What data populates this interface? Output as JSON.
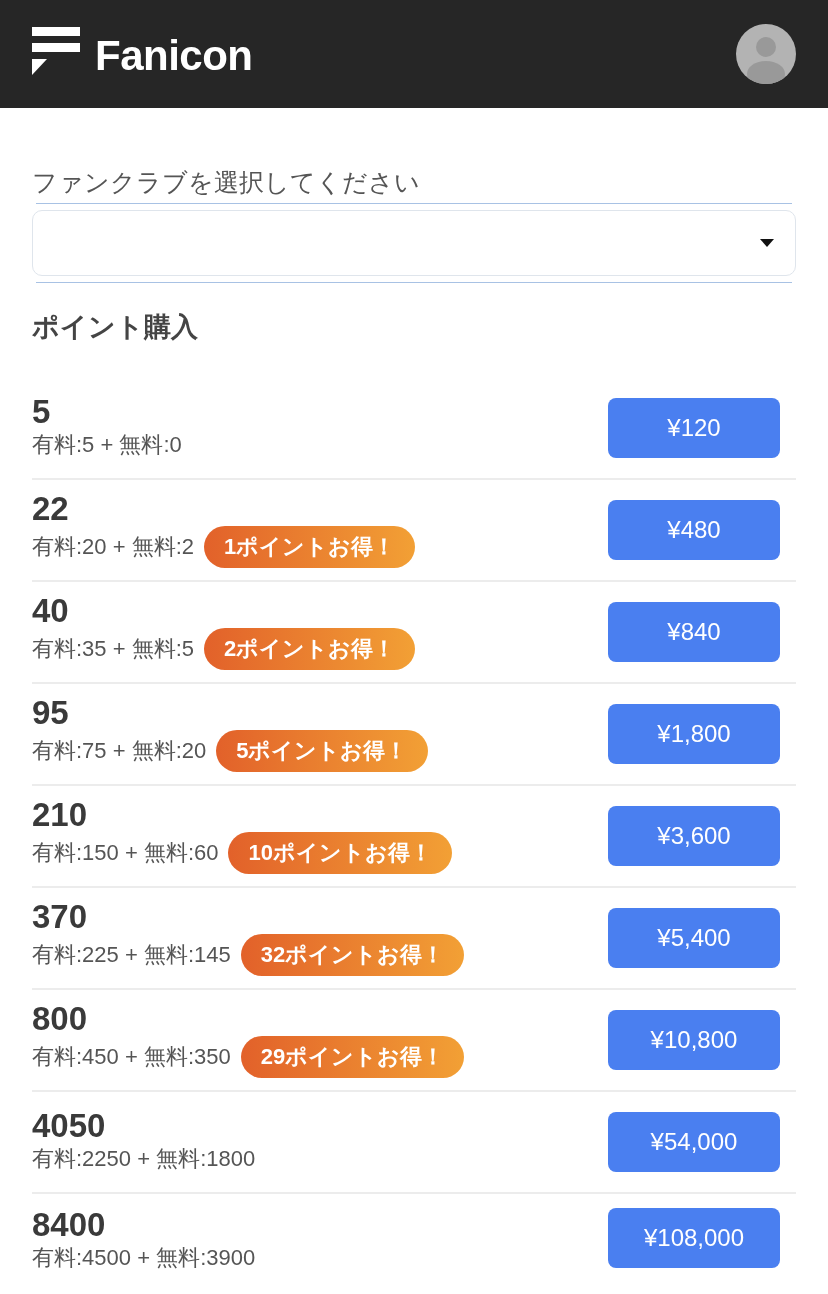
{
  "header": {
    "logo_text": "Fanicon"
  },
  "fanclub_select": {
    "label": "ファンクラブを選択してください"
  },
  "section_title": "ポイント購入",
  "plans": [
    {
      "points": "5",
      "breakdown": "有料:5 + 無料:0",
      "price": "¥120"
    },
    {
      "points": "22",
      "breakdown": "有料:20 + 無料:2",
      "badge": "1ポイントお得！",
      "price": "¥480"
    },
    {
      "points": "40",
      "breakdown": "有料:35 + 無料:5",
      "badge": "2ポイントお得！",
      "price": "¥840"
    },
    {
      "points": "95",
      "breakdown": "有料:75 + 無料:20",
      "badge": "5ポイントお得！",
      "price": "¥1,800"
    },
    {
      "points": "210",
      "breakdown": "有料:150 + 無料:60",
      "badge": "10ポイントお得！",
      "price": "¥3,600"
    },
    {
      "points": "370",
      "breakdown": "有料:225 + 無料:145",
      "badge": "32ポイントお得！",
      "price": "¥5,400"
    },
    {
      "points": "800",
      "breakdown": "有料:450 + 無料:350",
      "badge": "29ポイントお得！",
      "price": "¥10,800"
    },
    {
      "points": "4050",
      "breakdown": "有料:2250 + 無料:1800",
      "price": "¥54,000"
    },
    {
      "points": "8400",
      "breakdown": "有料:4500 + 無料:3900",
      "price": "¥108,000"
    }
  ]
}
